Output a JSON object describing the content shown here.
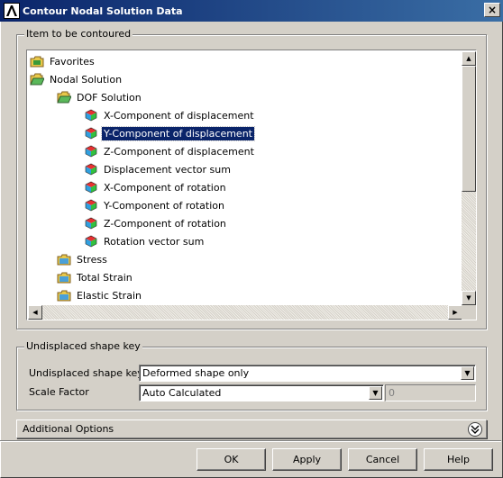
{
  "window": {
    "title": "Contour Nodal Solution Data"
  },
  "contour_group": {
    "legend": "Item to be contoured"
  },
  "tree": {
    "items": [
      {
        "label": "Favorites",
        "level": 0,
        "icon": "folder-bookmark-icon",
        "selected": false
      },
      {
        "label": "Nodal Solution",
        "level": 0,
        "icon": "folder-open-icon",
        "selected": false
      },
      {
        "label": "DOF Solution",
        "level": 1,
        "icon": "folder-open-icon",
        "selected": false
      },
      {
        "label": "X-Component of displacement",
        "level": 2,
        "icon": "cube-result-icon",
        "selected": false
      },
      {
        "label": "Y-Component of displacement",
        "level": 2,
        "icon": "cube-result-icon",
        "selected": true
      },
      {
        "label": "Z-Component of displacement",
        "level": 2,
        "icon": "cube-result-icon",
        "selected": false
      },
      {
        "label": "Displacement vector sum",
        "level": 2,
        "icon": "cube-result-icon",
        "selected": false
      },
      {
        "label": "X-Component of rotation",
        "level": 2,
        "icon": "cube-result-icon",
        "selected": false
      },
      {
        "label": "Y-Component of rotation",
        "level": 2,
        "icon": "cube-result-icon",
        "selected": false
      },
      {
        "label": "Z-Component of rotation",
        "level": 2,
        "icon": "cube-result-icon",
        "selected": false
      },
      {
        "label": "Rotation vector sum",
        "level": 2,
        "icon": "cube-result-icon",
        "selected": false
      },
      {
        "label": "Stress",
        "level": 1,
        "icon": "folder-closed-icon",
        "selected": false
      },
      {
        "label": "Total Strain",
        "level": 1,
        "icon": "folder-closed-icon",
        "selected": false
      },
      {
        "label": "Elastic Strain",
        "level": 1,
        "icon": "folder-closed-icon",
        "selected": false
      }
    ]
  },
  "undisplaced_group": {
    "legend": "Undisplaced shape key",
    "shape_key_label": "Undisplaced shape key",
    "shape_key_value": "Deformed shape only",
    "scale_factor_label": "Scale Factor",
    "scale_factor_value": "Auto Calculated",
    "scale_factor_text": "0"
  },
  "additional_options": {
    "label": "Additional Options"
  },
  "buttons": {
    "ok": "OK",
    "apply": "Apply",
    "cancel": "Cancel",
    "help": "Help"
  },
  "colors": {
    "title_bar": "#0a246a",
    "selection": "#0a246a",
    "dialog_bg": "#d4d0c8"
  }
}
